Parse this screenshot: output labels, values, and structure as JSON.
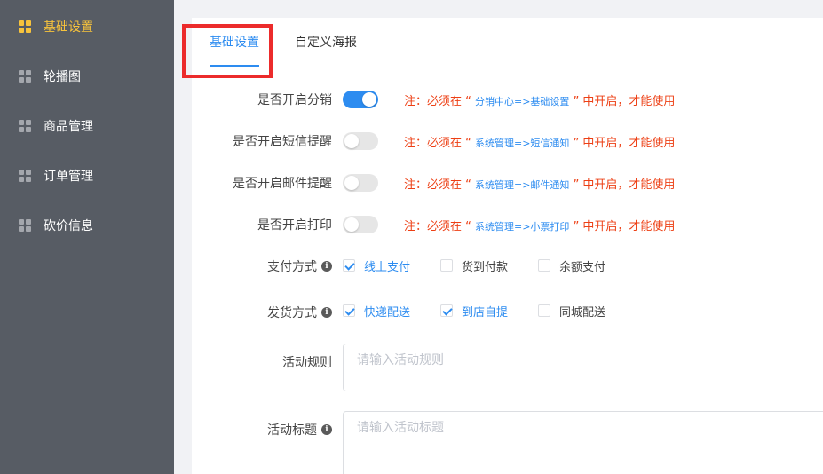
{
  "sidebar": {
    "items": [
      {
        "label": "基础设置",
        "active": true
      },
      {
        "label": "轮播图",
        "active": false
      },
      {
        "label": "商品管理",
        "active": false
      },
      {
        "label": "订单管理",
        "active": false
      },
      {
        "label": "砍价信息",
        "active": false
      }
    ]
  },
  "tabs": [
    {
      "label": "基础设置",
      "active": true
    },
    {
      "label": "自定义海报",
      "active": false
    }
  ],
  "form": {
    "switches": [
      {
        "label": "是否开启分销",
        "on": true,
        "note_pre": "注：必须在 “ ",
        "note_path": "分销中心=>基础设置",
        "note_post": " ” 中开启，才能使用"
      },
      {
        "label": "是否开启短信提醒",
        "on": false,
        "note_pre": "注：必须在 “ ",
        "note_path": "系统管理=>短信通知",
        "note_post": " ” 中开启，才能使用"
      },
      {
        "label": "是否开启邮件提醒",
        "on": false,
        "note_pre": "注：必须在 “ ",
        "note_path": "系统管理=>邮件通知",
        "note_post": " ” 中开启，才能使用"
      },
      {
        "label": "是否开启打印",
        "on": false,
        "note_pre": "注：必须在 “ ",
        "note_path": "系统管理=>小票打印",
        "note_post": " ” 中开启，才能使用"
      }
    ],
    "payment": {
      "label": "支付方式",
      "info_icon": "info-icon",
      "options": [
        {
          "label": "线上支付",
          "checked": true
        },
        {
          "label": "货到付款",
          "checked": false
        },
        {
          "label": "余额支付",
          "checked": false
        }
      ]
    },
    "delivery": {
      "label": "发货方式",
      "info_icon": "info-icon",
      "options": [
        {
          "label": "快递配送",
          "checked": true
        },
        {
          "label": "到店自提",
          "checked": true
        },
        {
          "label": "同城配送",
          "checked": false
        }
      ]
    },
    "rules": {
      "label": "活动规则",
      "placeholder": "请输入活动规则"
    },
    "title": {
      "label": "活动标题",
      "placeholder": "请输入活动标题"
    }
  },
  "colors": {
    "accent": "#2d8cf0",
    "sidebar_bg": "#575c64",
    "sidebar_active": "#f7c33c",
    "note_red": "#ed3f14",
    "highlight_red": "#ec2b2b"
  }
}
